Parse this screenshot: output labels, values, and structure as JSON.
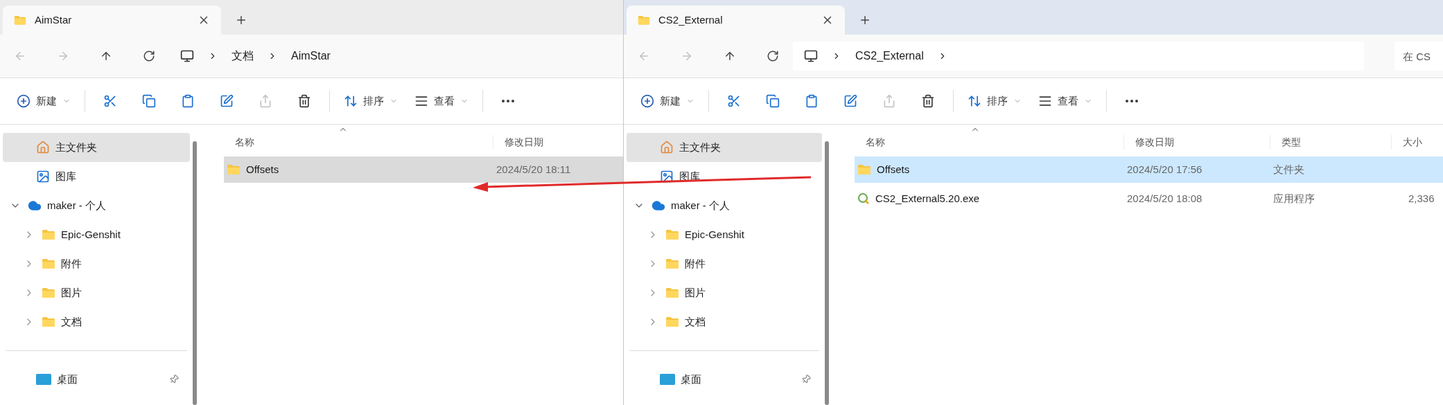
{
  "windows": [
    {
      "active": false,
      "tabs": [
        {
          "label": "AimStar",
          "selected": true
        }
      ],
      "breadcrumb": [
        "文档",
        "AimStar"
      ],
      "toolbar": [
        {
          "kind": "new",
          "label": "新建",
          "disabled": false
        },
        {
          "kind": "cut",
          "disabled": false
        },
        {
          "kind": "copy",
          "disabled": false
        },
        {
          "kind": "paste",
          "disabled": false
        },
        {
          "kind": "rename",
          "disabled": false
        },
        {
          "kind": "share",
          "disabled": true
        },
        {
          "kind": "delete",
          "disabled": false
        },
        {
          "kind": "sort",
          "label": "排序",
          "disabled": false
        },
        {
          "kind": "view",
          "label": "查看",
          "disabled": false
        },
        {
          "kind": "more",
          "disabled": false
        }
      ],
      "sidebar": [
        {
          "kind": "home",
          "label": "主文件夹",
          "selected": true
        },
        {
          "kind": "gallery",
          "label": "图库",
          "selected": false
        },
        {
          "kind": "cloud",
          "label": "maker - 个人",
          "selected": false,
          "expanded": true,
          "children": [
            {
              "kind": "folder",
              "label": "Epic-Genshit",
              "selected": false,
              "expanded": false
            },
            {
              "kind": "folder",
              "label": "附件",
              "selected": false,
              "expanded": false
            },
            {
              "kind": "folder",
              "label": "图片",
              "selected": false,
              "expanded": false
            },
            {
              "kind": "folder",
              "label": "文档",
              "selected": false,
              "expanded": false
            }
          ]
        }
      ],
      "pinned": [
        {
          "kind": "desktop",
          "label": "桌面",
          "pinned": true
        }
      ],
      "columns": [
        "名称",
        "修改日期"
      ],
      "rows": [
        {
          "kind": "folder",
          "cells": [
            "Offsets",
            "2024/5/20 18:11"
          ],
          "selected": true
        }
      ]
    },
    {
      "active": true,
      "tabs": [
        {
          "label": "CS2_External",
          "selected": true
        }
      ],
      "breadcrumb": [
        "CS2_External"
      ],
      "search": {
        "placeholder": "在 CS"
      },
      "toolbar": [
        {
          "kind": "new",
          "label": "新建",
          "disabled": false
        },
        {
          "kind": "cut",
          "disabled": false
        },
        {
          "kind": "copy",
          "disabled": false
        },
        {
          "kind": "paste",
          "disabled": false
        },
        {
          "kind": "rename",
          "disabled": false
        },
        {
          "kind": "share",
          "disabled": true
        },
        {
          "kind": "delete",
          "disabled": false
        },
        {
          "kind": "sort",
          "label": "排序",
          "disabled": false
        },
        {
          "kind": "view",
          "label": "查看",
          "disabled": false
        },
        {
          "kind": "more",
          "disabled": false
        }
      ],
      "sidebar": [
        {
          "kind": "home",
          "label": "主文件夹",
          "selected": true
        },
        {
          "kind": "gallery",
          "label": "图库",
          "selected": false
        },
        {
          "kind": "cloud",
          "label": "maker - 个人",
          "selected": false,
          "expanded": true,
          "children": [
            {
              "kind": "folder",
              "label": "Epic-Genshit",
              "selected": false,
              "expanded": false
            },
            {
              "kind": "folder",
              "label": "附件",
              "selected": false,
              "expanded": false
            },
            {
              "kind": "folder",
              "label": "图片",
              "selected": false,
              "expanded": false
            },
            {
              "kind": "folder",
              "label": "文档",
              "selected": false,
              "expanded": false
            }
          ]
        }
      ],
      "pinned": [
        {
          "kind": "desktop",
          "label": "桌面",
          "pinned": true
        }
      ],
      "columns": [
        "名称",
        "修改日期",
        "类型",
        "大小"
      ],
      "rows": [
        {
          "kind": "folder",
          "cells": [
            "Offsets",
            "2024/5/20 17:56",
            "文件夹"
          ],
          "selected": true
        },
        {
          "kind": "exe",
          "cells": [
            "CS2_External5.20.exe",
            "2024/5/20 18:08",
            "应用程序",
            "2,336"
          ],
          "selected": false
        }
      ]
    }
  ]
}
